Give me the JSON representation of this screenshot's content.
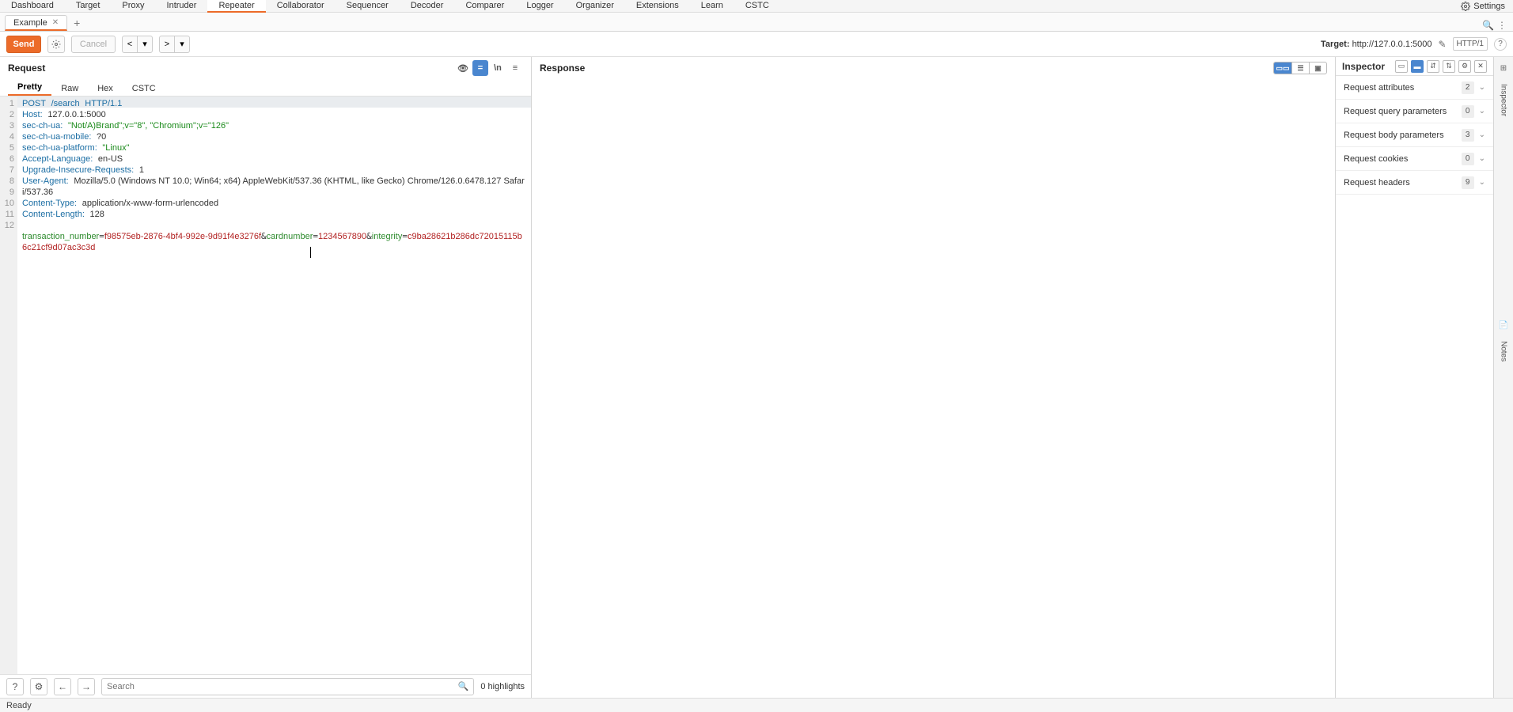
{
  "menu": [
    "Dashboard",
    "Target",
    "Proxy",
    "Intruder",
    "Repeater",
    "Collaborator",
    "Sequencer",
    "Decoder",
    "Comparer",
    "Logger",
    "Organizer",
    "Extensions",
    "Learn",
    "CSTC"
  ],
  "menu_active": "Repeater",
  "settings_label": "Settings",
  "tab": {
    "name": "Example",
    "add": "+"
  },
  "actions": {
    "send": "Send",
    "cancel": "Cancel",
    "prev": "<",
    "prev_dd": "▾",
    "next": ">",
    "next_dd": "▾"
  },
  "target": {
    "prefix": "Target: ",
    "value": "http://127.0.0.1:5000"
  },
  "http_version": "HTTP/1",
  "request": {
    "title": "Request",
    "view_tabs": [
      "Pretty",
      "Raw",
      "Hex",
      "CSTC"
    ],
    "view_active": "Pretty",
    "lines": [
      "1",
      "2",
      "3",
      "4",
      "5",
      "6",
      "7",
      "8",
      "",
      "9",
      "10",
      "11",
      "12"
    ],
    "l1_method": "POST",
    "l1_path": "/search",
    "l1_proto": "HTTP/1.1",
    "h_host_k": "Host:",
    "h_host_v": "127.0.0.1:5000",
    "h_secchua_k": "sec-ch-ua:",
    "h_secchua_v": "\"Not/A)Brand\";v=\"8\", \"Chromium\";v=\"126\"",
    "h_secmob_k": "sec-ch-ua-mobile:",
    "h_secmob_v": "?0",
    "h_secplat_k": "sec-ch-ua-platform:",
    "h_secplat_v": "\"Linux\"",
    "h_acclang_k": "Accept-Language:",
    "h_acclang_v": "en-US",
    "h_upins_k": "Upgrade-Insecure-Requests:",
    "h_upins_v": "1",
    "h_ua_k": "User-Agent:",
    "h_ua_v": "Mozilla/5.0 (Windows NT 10.0; Win64; x64) AppleWebKit/537.36 (KHTML, like Gecko) Chrome/126.0.6478.127 Safari/537.36",
    "h_ct_k": "Content-Type:",
    "h_ct_v": "application/x-www-form-urlencoded",
    "h_cl_k": "Content-Length:",
    "h_cl_v": "128",
    "body_k1": "transaction_number",
    "body_v1": "f98575eb-2876-4bf4-992e-9d91f4e3276f",
    "body_k2": "cardnumber",
    "body_v2": "1234567890",
    "body_k3": "integrity",
    "body_v3": "c9ba28621b286dc72015115b6c21cf9d07ac3c3d",
    "search_placeholder": "Search",
    "highlights": "0 highlights"
  },
  "response": {
    "title": "Response"
  },
  "inspector": {
    "title": "Inspector",
    "rows": [
      {
        "label": "Request attributes",
        "count": "2"
      },
      {
        "label": "Request query parameters",
        "count": "0"
      },
      {
        "label": "Request body parameters",
        "count": "3"
      },
      {
        "label": "Request cookies",
        "count": "0"
      },
      {
        "label": "Request headers",
        "count": "9"
      }
    ]
  },
  "side": {
    "inspector": "Inspector",
    "notes": "Notes"
  },
  "status": "Ready"
}
